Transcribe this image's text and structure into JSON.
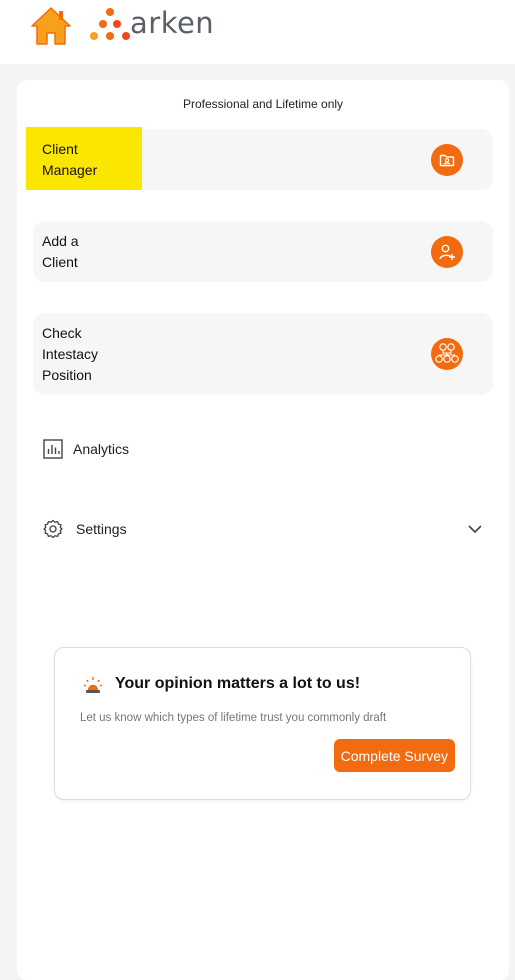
{
  "header": {
    "brand": "arken",
    "home_icon": "home-icon",
    "brand_colors": [
      "#f8a01c",
      "#f26b10",
      "#f04a14"
    ]
  },
  "panel": {
    "notice": "Professional and Lifetime only",
    "cards": [
      {
        "label": "Client\nManager",
        "icon": "client-folder-icon",
        "highlighted": true
      },
      {
        "label": "Add a\nClient",
        "icon": "add-user-icon",
        "highlighted": false
      },
      {
        "label": "Check\nIntestacy\nPosition",
        "icon": "family-tree-icon",
        "highlighted": false
      }
    ],
    "nav": [
      {
        "label": "Analytics",
        "icon": "bar-chart-icon"
      },
      {
        "label": "Settings",
        "icon": "gear-icon",
        "trailing_icon": "chevron-down-icon"
      }
    ]
  },
  "survey": {
    "icon": "alarm-light-icon",
    "title": "Your opinion matters a lot to us!",
    "body": "Let us know which types of lifetime trust you commonly draft",
    "button_label": "Complete Survey"
  },
  "colors": {
    "accent": "#f26b10",
    "highlight": "#fbe600",
    "card_bg": "#f6f6f7",
    "page_bg": "#f4f4f5"
  }
}
